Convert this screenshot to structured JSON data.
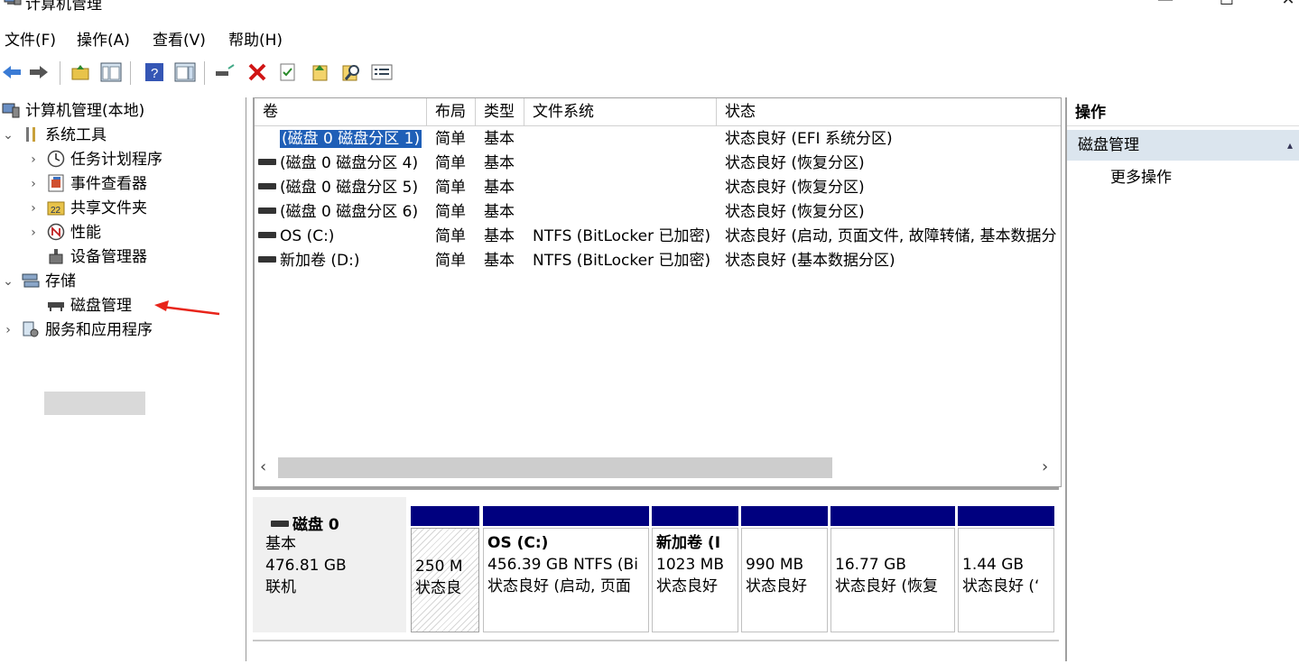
{
  "window": {
    "title": "计算机管理",
    "min": "—",
    "max": "☐",
    "close": "✕"
  },
  "menu": [
    "文件(F)",
    "操作(A)",
    "查看(V)",
    "帮助(H)"
  ],
  "tree": {
    "root": "计算机管理(本地)",
    "system_tools": "系统工具",
    "task_scheduler": "任务计划程序",
    "event_viewer": "事件查看器",
    "shared_folders": "共享文件夹",
    "performance": "性能",
    "device_manager": "设备管理器",
    "storage": "存储",
    "disk_management": "磁盘管理",
    "services_apps": "服务和应用程序"
  },
  "volume_list": {
    "columns": [
      "卷",
      "布局",
      "类型",
      "文件系统",
      "状态"
    ],
    "rows": [
      {
        "vol": "(磁盘 0 磁盘分区 1)",
        "layout": "简单",
        "type": "基本",
        "fs": "",
        "status": "状态良好 (EFI 系统分区)"
      },
      {
        "vol": "(磁盘 0 磁盘分区 4)",
        "layout": "简单",
        "type": "基本",
        "fs": "",
        "status": "状态良好 (恢复分区)"
      },
      {
        "vol": "(磁盘 0 磁盘分区 5)",
        "layout": "简单",
        "type": "基本",
        "fs": "",
        "status": "状态良好 (恢复分区)"
      },
      {
        "vol": "(磁盘 0 磁盘分区 6)",
        "layout": "简单",
        "type": "基本",
        "fs": "",
        "status": "状态良好 (恢复分区)"
      },
      {
        "vol": "OS (C:)",
        "layout": "简单",
        "type": "基本",
        "fs": "NTFS (BitLocker 已加密)",
        "status": "状态良好 (启动, 页面文件, 故障转储, 基本数据分"
      },
      {
        "vol": "新加卷 (D:)",
        "layout": "简单",
        "type": "基本",
        "fs": "NTFS (BitLocker 已加密)",
        "status": "状态良好 (基本数据分区)"
      }
    ],
    "scroll_left": "‹",
    "scroll_right": "›"
  },
  "disk": {
    "name": "磁盘 0",
    "type": "基本",
    "size": "476.81 GB",
    "state": "联机",
    "partitions": [
      {
        "title": "",
        "line1": "250 M",
        "line2": "状态良"
      },
      {
        "title": "OS  (C:)",
        "line1": "456.39 GB NTFS (Bi",
        "line2": "状态良好 (启动, 页面"
      },
      {
        "title": "新加卷  (I",
        "line1": "1023 MB",
        "line2": "状态良好"
      },
      {
        "title": "",
        "line1": "990 MB",
        "line2": "状态良好"
      },
      {
        "title": "",
        "line1": "16.77 GB",
        "line2": "状态良好 (恢复"
      },
      {
        "title": "",
        "line1": "1.44 GB",
        "line2": "状态良好 (‘"
      }
    ]
  },
  "actions": {
    "header": "操作",
    "section": "磁盘管理",
    "more": "更多操作",
    "collapse": "▴"
  },
  "colors": {
    "accent": "#1f5fb7",
    "partition_bar": "#00007f",
    "annotation": "#e8251b"
  }
}
